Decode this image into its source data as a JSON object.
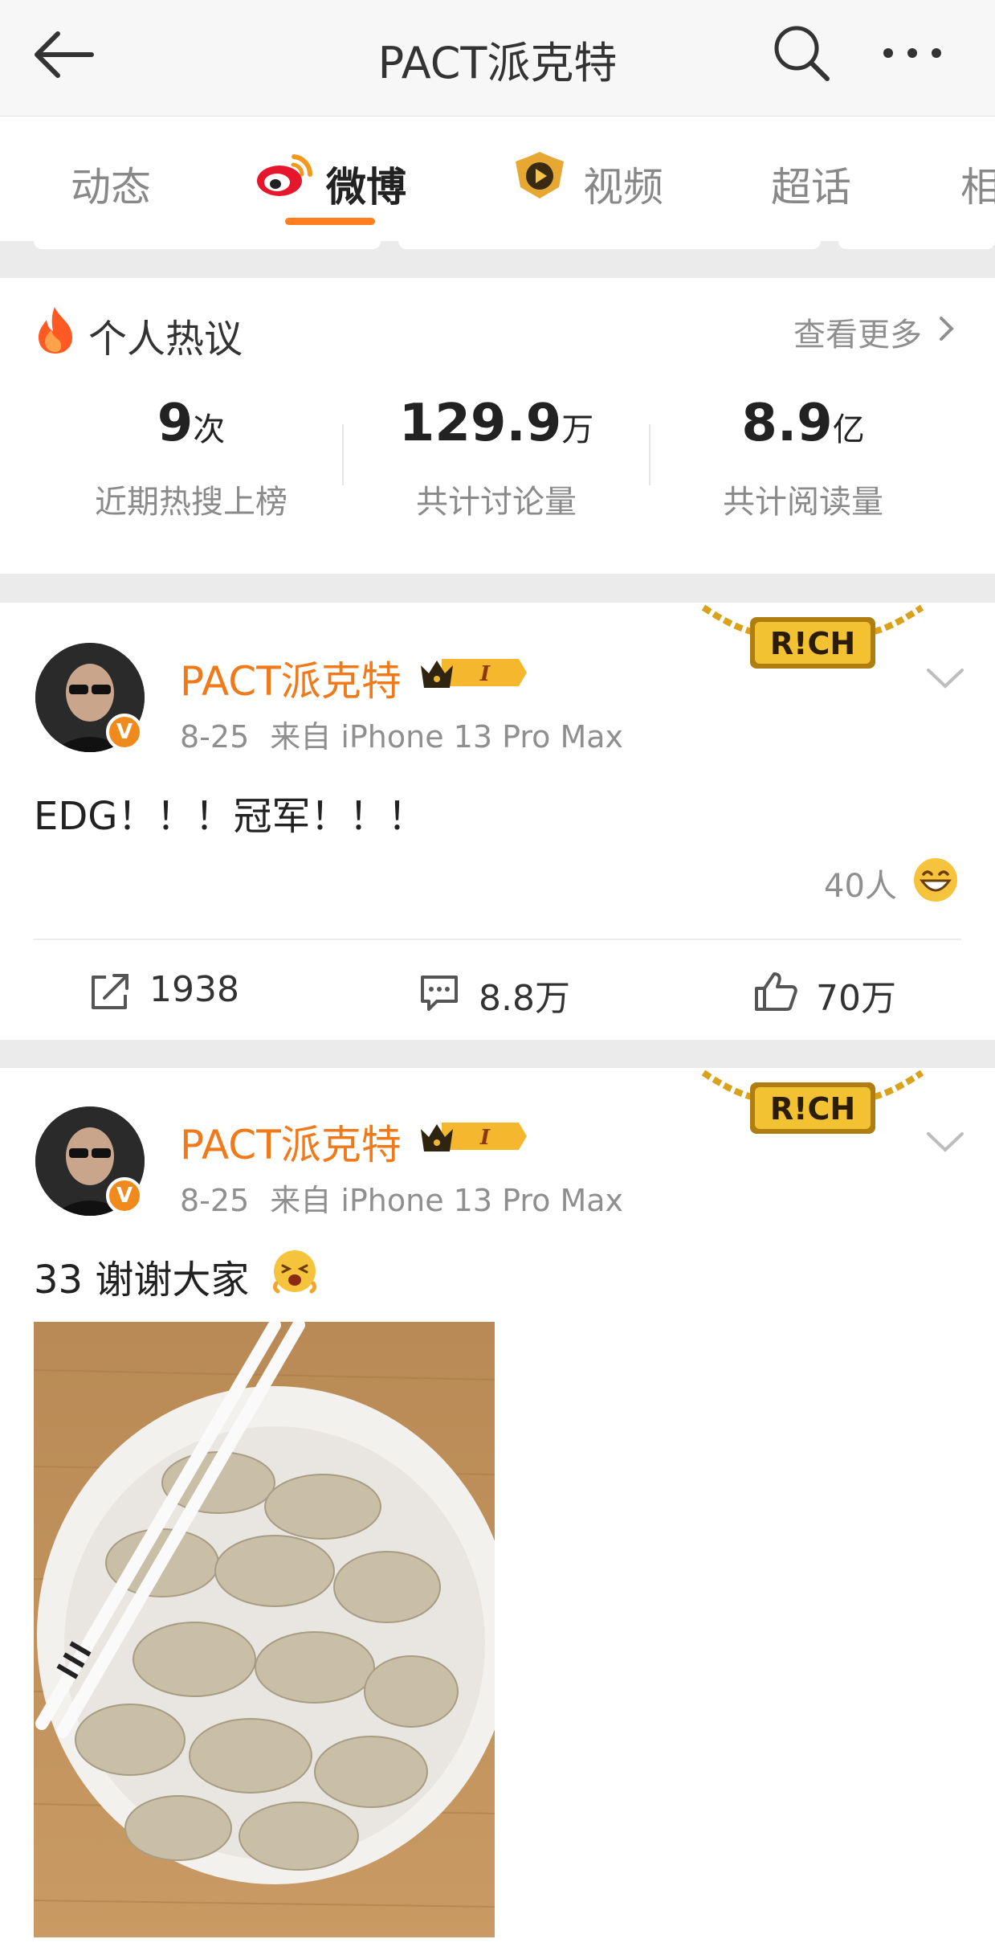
{
  "header": {
    "title": "PACT派克特"
  },
  "tabs": [
    {
      "label": "动态"
    },
    {
      "label": "微博"
    },
    {
      "label": "视频"
    },
    {
      "label": "超话"
    },
    {
      "label": "相"
    }
  ],
  "hot": {
    "title": "个人热议",
    "more_label": "查看更多",
    "stats": [
      {
        "value": "9",
        "unit": "次",
        "label": "近期热搜上榜"
      },
      {
        "value": "129.9",
        "unit": "万",
        "label": "共计讨论量"
      },
      {
        "value": "8.9",
        "unit": "亿",
        "label": "共计阅读量"
      }
    ]
  },
  "posts": [
    {
      "author": "PACT派克特",
      "badge": "V",
      "level": "I",
      "decoration": "R!CH",
      "date": "8-25",
      "source": "来自 iPhone 13 Pro Max",
      "text": "EDG！！！冠军！！！",
      "reactions": "40人",
      "reposts": "1938",
      "comments": "8.8万",
      "likes": "70万"
    },
    {
      "author": "PACT派克特",
      "badge": "V",
      "level": "I",
      "decoration": "R!CH",
      "date": "8-25",
      "source": "来自 iPhone 13 Pro Max",
      "text": "33 谢谢大家"
    }
  ]
}
